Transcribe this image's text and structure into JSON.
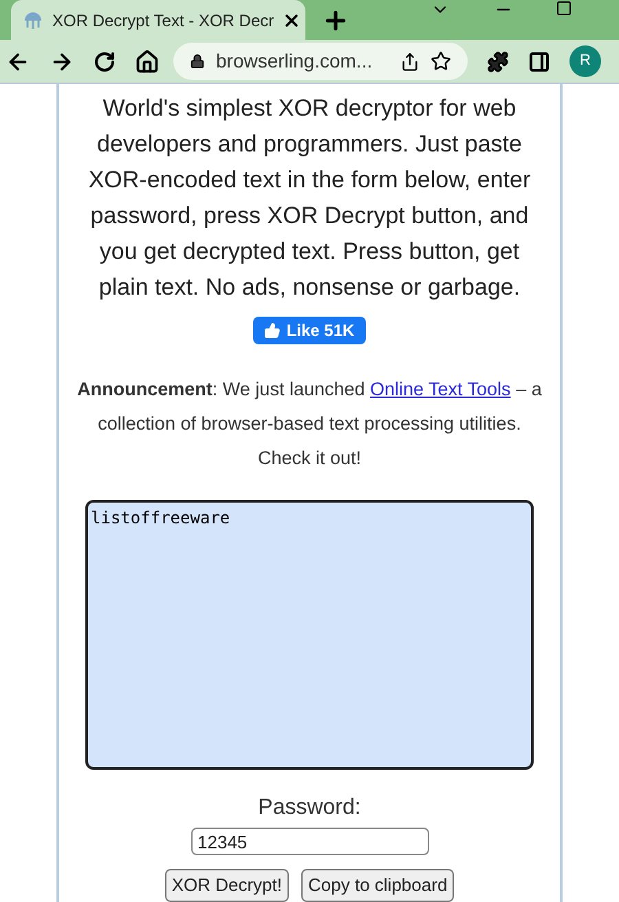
{
  "browser": {
    "tab": {
      "title": "XOR Decrypt Text - XOR Decr",
      "selected": true
    },
    "address": "browserling.com...",
    "profile": "R"
  },
  "intro": "World's simplest XOR decryptor for web developers and programmers. Just paste XOR-encoded text in the form below, enter password, press XOR Decrypt button, and you get decrypted text. Press button, get plain text. No ads, nonsense or garbage.",
  "like": {
    "label": "Like 51K"
  },
  "announcement": {
    "before": "**Announcement**: We just launched ",
    "link": "Online Text Tools",
    "after": " – a collection of browser-based text processing utilities. Check it out!"
  },
  "input_text": "listoffreeware",
  "password": {
    "label": "Password:",
    "value": "12345"
  },
  "buttons": [
    "XOR Decrypt!",
    "Copy to clipboard"
  ]
}
